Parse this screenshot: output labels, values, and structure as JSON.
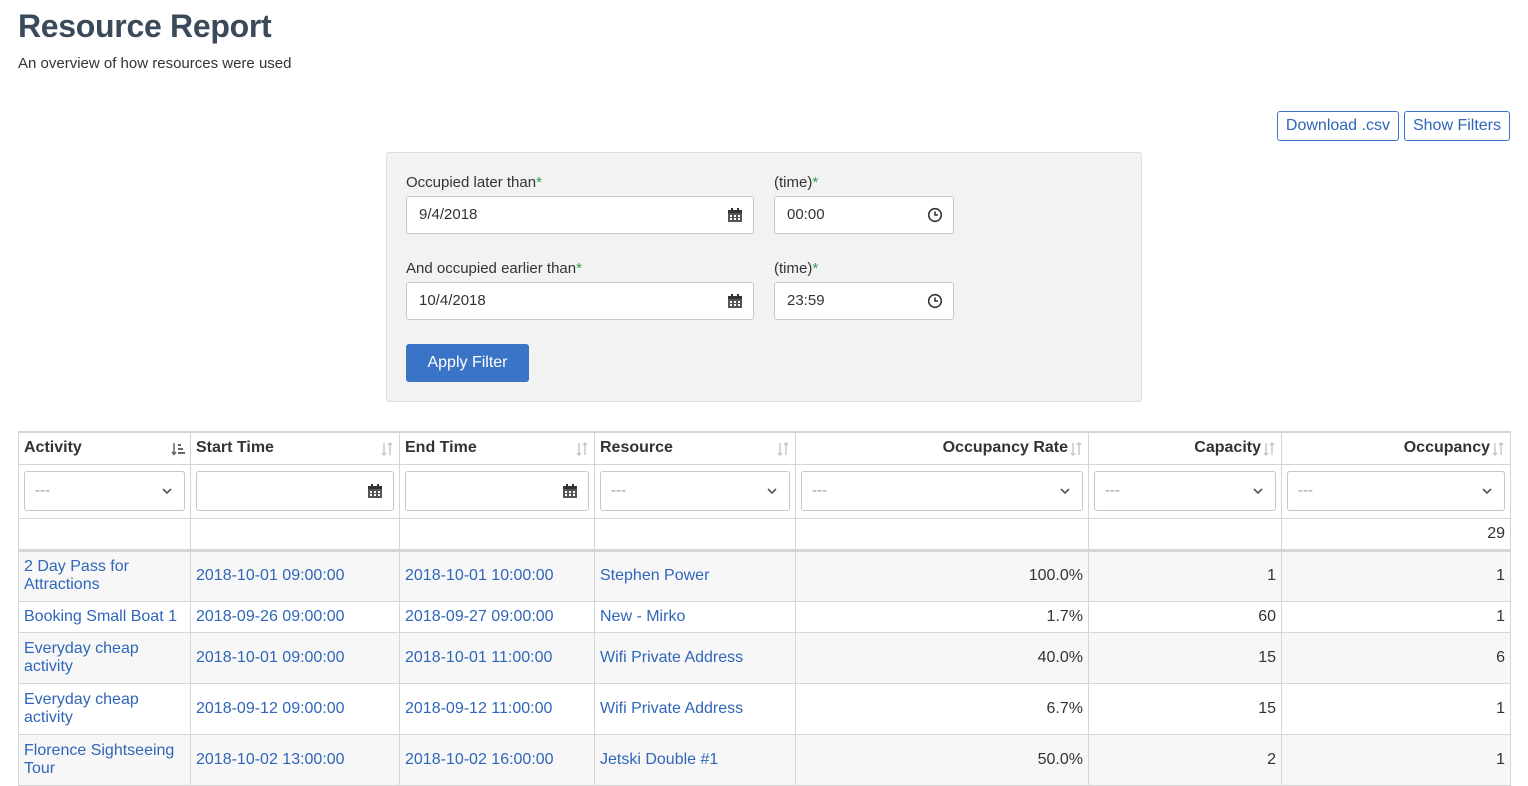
{
  "header": {
    "title": "Resource Report",
    "subtitle": "An overview of how resources were used"
  },
  "actions": {
    "download_label": "Download .csv",
    "show_filters_label": "Show Filters"
  },
  "filter": {
    "occupied_later_label": "Occupied later than",
    "occupied_later_date": "9/4/2018",
    "time_label": "(time)",
    "occupied_later_time": "00:00",
    "occupied_earlier_label": "And occupied earlier than",
    "occupied_earlier_date": "10/4/2018",
    "occupied_earlier_time": "23:59",
    "required_mark": "*",
    "apply_label": "Apply Filter"
  },
  "table": {
    "columns": [
      "Activity",
      "Start Time",
      "End Time",
      "Resource",
      "Occupancy Rate",
      "Capacity",
      "Occupancy"
    ],
    "select_placeholder": "---",
    "total_occupancy": "29",
    "rows": [
      {
        "activity": "2 Day Pass for Attractions",
        "start": "2018-10-01 09:00:00",
        "end": "2018-10-01 10:00:00",
        "resource": "Stephen Power",
        "rate": "100.0%",
        "capacity": "1",
        "occupancy": "1"
      },
      {
        "activity": "Booking Small Boat 1",
        "start": "2018-09-26 09:00:00",
        "end": "2018-09-27 09:00:00",
        "resource": "New - Mirko",
        "rate": "1.7%",
        "capacity": "60",
        "occupancy": "1"
      },
      {
        "activity": "Everyday cheap activity",
        "start": "2018-10-01 09:00:00",
        "end": "2018-10-01 11:00:00",
        "resource": "Wifi Private Address",
        "rate": "40.0%",
        "capacity": "15",
        "occupancy": "6"
      },
      {
        "activity": "Everyday cheap activity",
        "start": "2018-09-12 09:00:00",
        "end": "2018-09-12 11:00:00",
        "resource": "Wifi Private Address",
        "rate": "6.7%",
        "capacity": "15",
        "occupancy": "1"
      },
      {
        "activity": "Florence Sightseeing Tour",
        "start": "2018-10-02 13:00:00",
        "end": "2018-10-02 16:00:00",
        "resource": "Jetski Double #1",
        "rate": "50.0%",
        "capacity": "2",
        "occupancy": "1"
      }
    ]
  },
  "colors": {
    "accent": "#3a74c7",
    "link": "#2f66b8",
    "required": "#2e9e4f",
    "title": "#3b4a5a"
  },
  "icons": [
    "calendar-icon",
    "clock-icon",
    "sort-icon",
    "sort-asc-icon",
    "chevron-down-icon"
  ]
}
